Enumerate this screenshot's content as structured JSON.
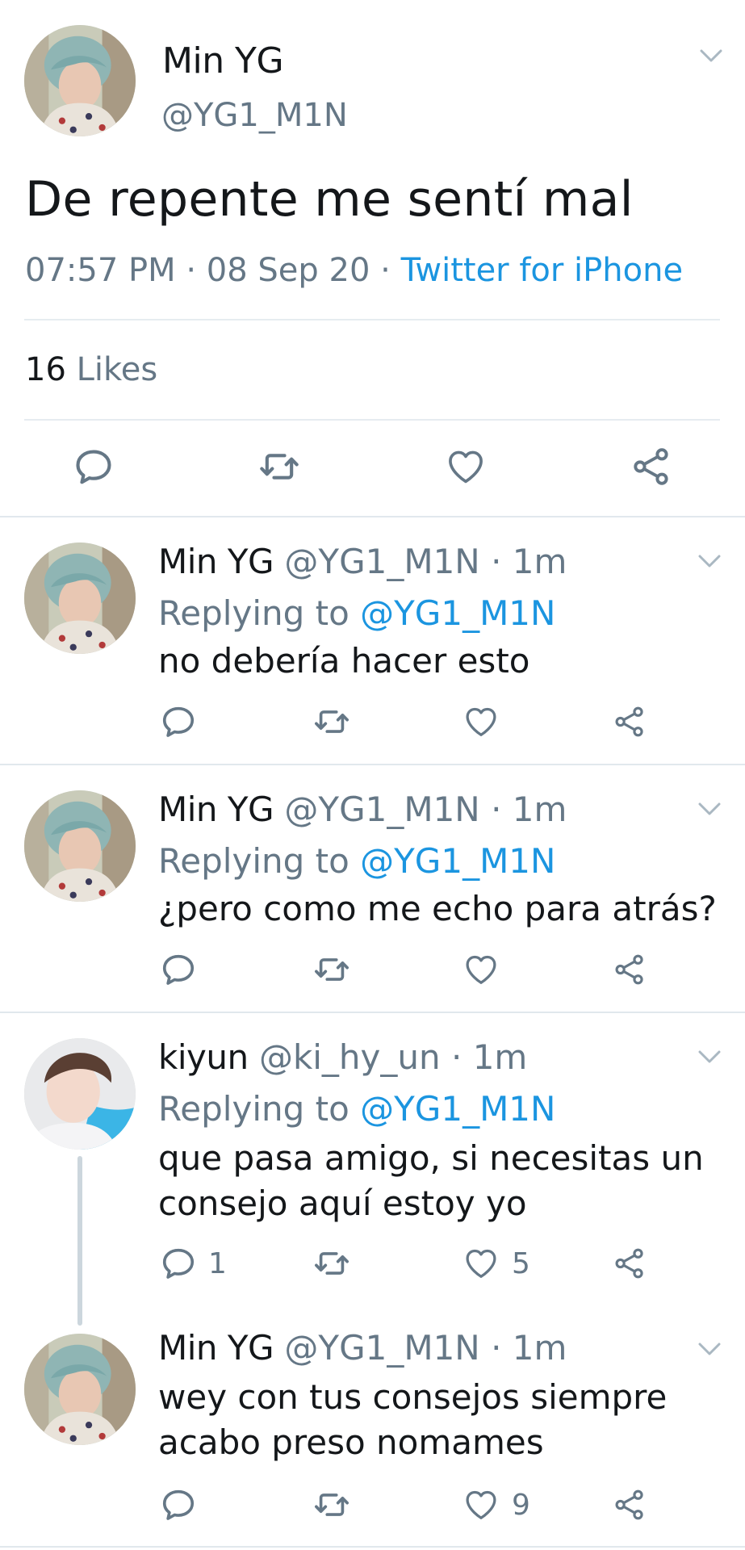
{
  "main_tweet": {
    "name": "Min YG",
    "handle": "@YG1_M1N",
    "text": "De repente me sentí mal",
    "time": "07:57 PM",
    "sep1": " · ",
    "date": "08 Sep 20",
    "sep2": " · ",
    "source": "Twitter for iPhone",
    "likes_count": "16",
    "likes_label": " Likes",
    "icons": [
      "reply-icon",
      "retweet-icon",
      "like-icon",
      "share-icon",
      "chevron-down-icon"
    ]
  },
  "replies": [
    {
      "name": "Min YG",
      "handle": " @YG1_M1N · 1m",
      "replying_label": "Replying to ",
      "replying_to": "@YG1_M1N",
      "text": "no debería hacer esto"
    },
    {
      "name": "Min YG",
      "handle": " @YG1_M1N · 1m",
      "replying_label": "Replying to ",
      "replying_to": "@YG1_M1N",
      "text": "¿pero como me echo para atrás?"
    },
    {
      "name": "kiyun",
      "handle": " @ki_hy_un · 1m",
      "replying_label": "Replying to ",
      "replying_to": "@YG1_M1N",
      "text_line1": "que pasa amigo, si necesitas un",
      "text_line2": "consejo aquí estoy yo",
      "reply_count": "1",
      "like_count": "5"
    },
    {
      "name": "Min YG",
      "handle": " @YG1_M1N · 1m",
      "text_line1": "wey con tus consejos siempre",
      "text_line2": "acabo preso nomames",
      "like_count": "9"
    }
  ],
  "colors": {
    "text": "#14171a",
    "secondary": "#657786",
    "link": "#1b95e0",
    "divider": "#e1e8ed",
    "thread_line": "#ccd6dd"
  }
}
